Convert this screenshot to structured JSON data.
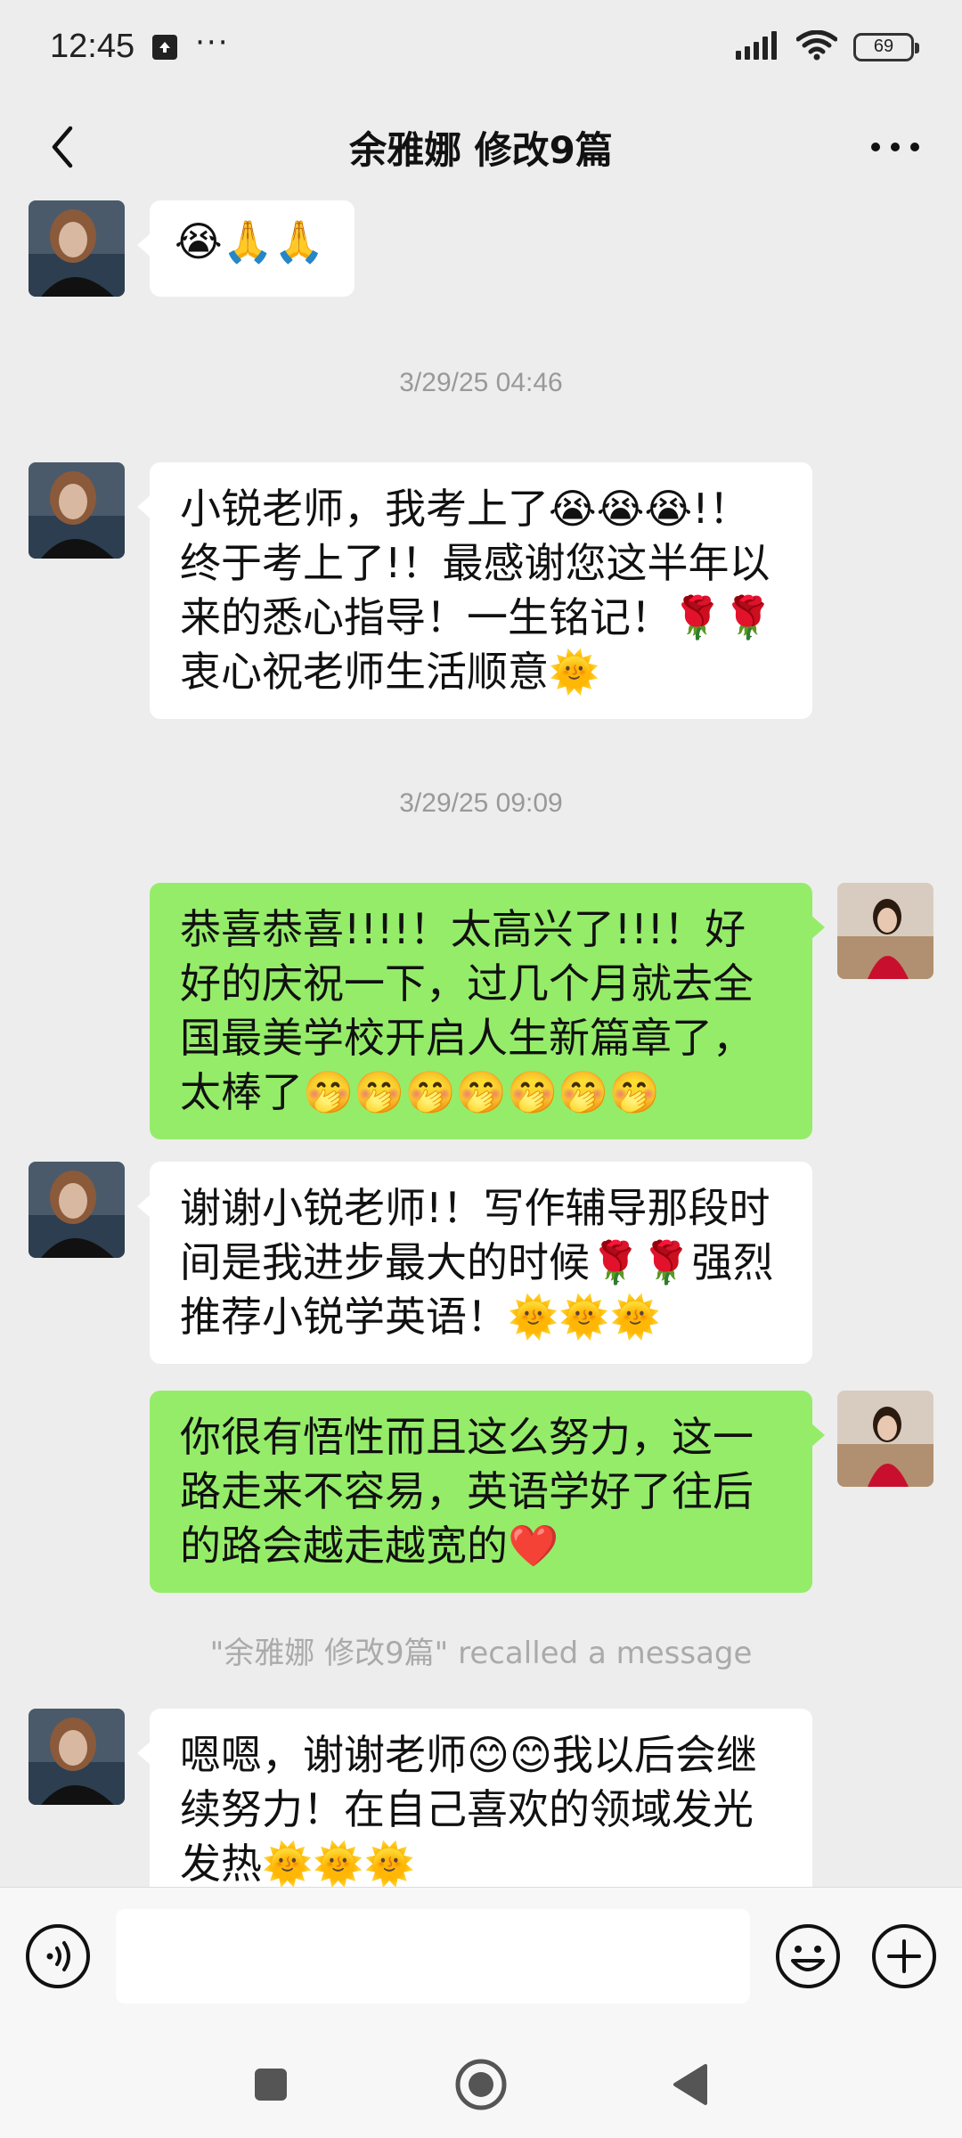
{
  "status_bar": {
    "time": "12:45",
    "dots": "···",
    "battery": "69",
    "icons": [
      "upload-icon",
      "signal-icon",
      "wifi-icon",
      "battery-icon"
    ]
  },
  "header": {
    "title": "余雅娜 修改9篇",
    "back_icon": "chevron-left-icon",
    "more_icon": "more-dots-icon"
  },
  "messages": {
    "m1": {
      "sender": "other",
      "text": "😭🙏🙏"
    },
    "ts1": "3/29/25 04:46",
    "m2": {
      "sender": "other",
      "text": "小锐老师，我考上了😭😭😭!！终于考上了!！最感谢您这半年以来的悉心指导！一生铭记！🌹🌹衷心祝老师生活顺意🌞"
    },
    "ts2": "3/29/25 09:09",
    "m3": {
      "sender": "me",
      "text": "恭喜恭喜!!!!！太高兴了!!!！好好的庆祝一下，过几个月就去全国最美学校开启人生新篇章了，太棒了🤭🤭🤭🤭🤭🤭🤭"
    },
    "m4": {
      "sender": "other",
      "text": "谢谢小锐老师!！写作辅导那段时间是我进步最大的时候🌹🌹强烈推荐小锐学英语！🌞🌞🌞"
    },
    "m5": {
      "sender": "me",
      "text": "你很有悟性而且这么努力，这一路走来不容易，英语学好了往后的路会越走越宽的❤️"
    },
    "recall": "\"余雅娜 修改9篇\" recalled a message",
    "m6": {
      "sender": "other",
      "text": "嗯嗯，谢谢老师😊😊我以后会继续努力！在自己喜欢的领域发光发热🌞🌞🌞"
    }
  },
  "input_bar": {
    "placeholder": "",
    "icons": [
      "voice-icon",
      "emoji-icon",
      "plus-icon"
    ]
  },
  "nav_bar": {
    "icons": [
      "recents-square-icon",
      "home-circle-icon",
      "back-triangle-icon"
    ]
  },
  "colors": {
    "background": "#ededed",
    "my_bubble": "#95ec69",
    "other_bubble": "#ffffff",
    "timestamp": "#999999"
  }
}
